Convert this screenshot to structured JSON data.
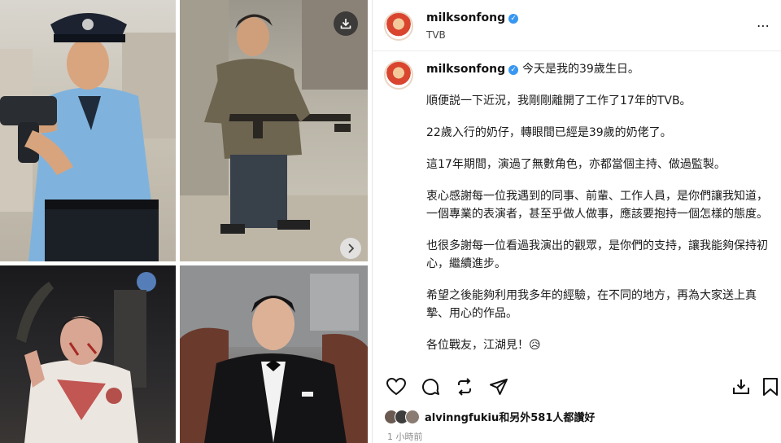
{
  "header": {
    "username": "milksonfong",
    "subtitle": "TVB",
    "more_icon": "more-horizontal-icon"
  },
  "caption": {
    "username": "milksonfong",
    "line1": "今天是我的39歲生日。",
    "paragraphs": [
      "順便説一下近況，我剛剛離開了工作了17年的TVB。",
      "22歲入行的奶仔，轉眼間已經是39歲的奶佬了。",
      "這17年期間，演過了無數角色，亦都當個主持、做過監製。",
      "衷心感謝每一位我遇到的同事、前輩、工作人員，是你們讓我知道，一個專業的表演者，甚至乎做人做事，應該要抱持一個怎樣的態度。",
      "也很多謝每一位看過我演出的觀眾，是你們的支持，讓我能夠保持初心，繼續進步。",
      "希望之後能夠利用我多年的經驗，在不同的地方，再為大家送上真摯、用心的作品。",
      "各位戰友，江湖見！😥"
    ]
  },
  "actions": {
    "like_icon": "heart-icon",
    "comment_icon": "comment-icon",
    "share_icon": "repost-icon",
    "send_icon": "send-icon",
    "save_icon": "bookmark-icon",
    "download_icon": "download-icon"
  },
  "likes": {
    "text": "alvinngfukiu和另外581人都讚好"
  },
  "timestamp": "1 小時前",
  "colors": {
    "verified": "#3897f0",
    "text": "#111111",
    "muted": "#8e8e8e"
  }
}
